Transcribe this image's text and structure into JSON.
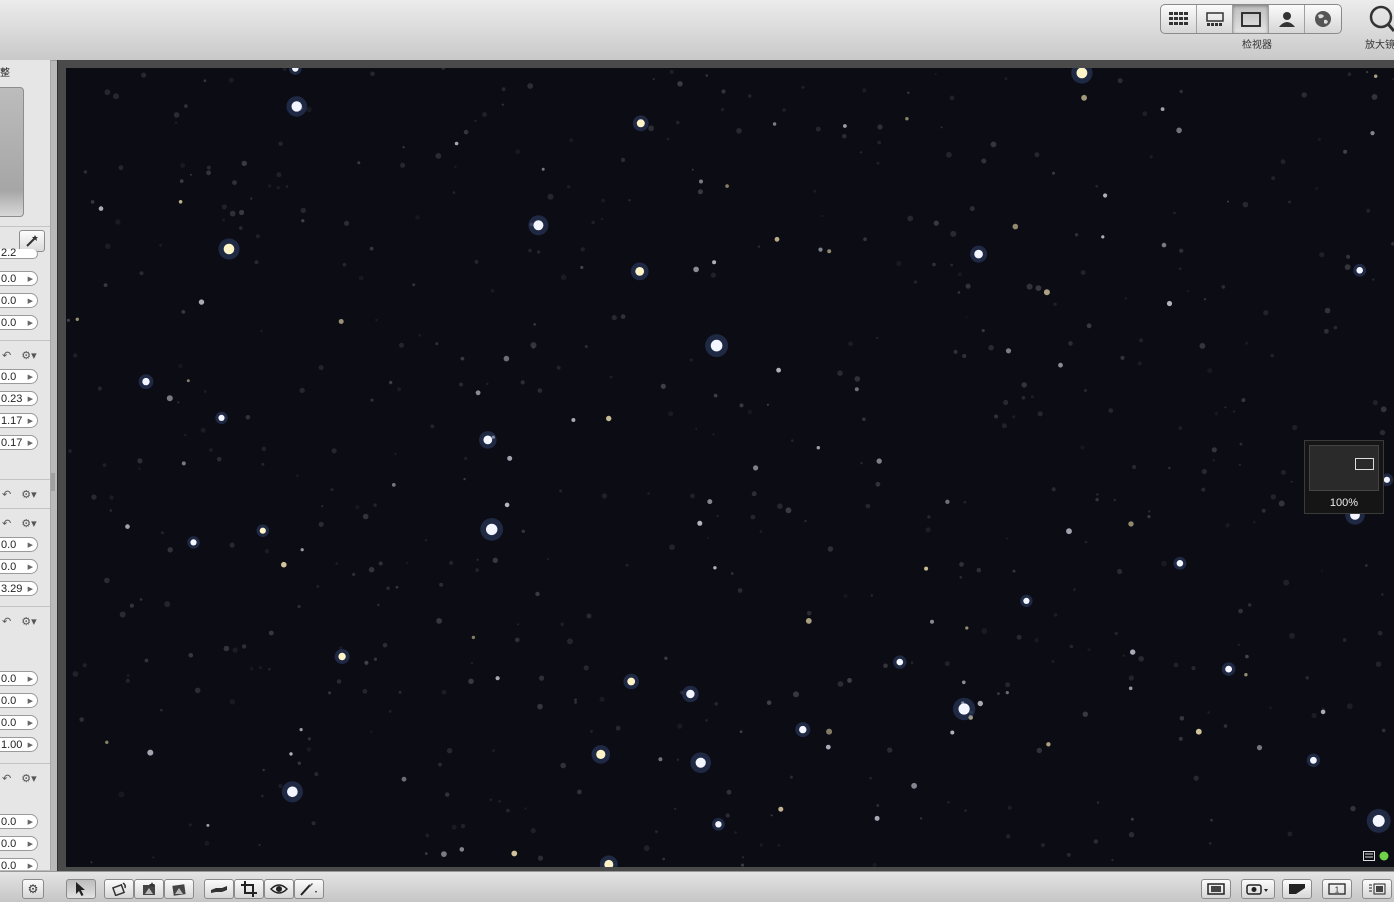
{
  "toolbar": {
    "views": [
      {
        "icon": "grid-view-icon",
        "active": false
      },
      {
        "icon": "split-view-icon",
        "active": false
      },
      {
        "icon": "viewer-icon",
        "active": true
      },
      {
        "icon": "faces-icon",
        "active": false
      },
      {
        "icon": "places-icon",
        "active": false
      }
    ],
    "viewer_label": "检视器",
    "zoom_label": "放大镜"
  },
  "adjust_panel": {
    "title": "整",
    "partial_value": "2.2",
    "group1": [
      "0.0",
      "0.0",
      "0.0"
    ],
    "group2": [
      "0.0",
      "0.23",
      "1.17",
      "0.17"
    ],
    "group3": [
      "0.0",
      "0.0",
      "3.29"
    ],
    "group4": [
      "0.0",
      "0.0",
      "0.0",
      "1.00"
    ],
    "group5": [
      "0.0",
      "0.0",
      "0.0"
    ]
  },
  "loupe": {
    "zoom": "100%"
  },
  "colors": {
    "photo_bg": "#0b0c14",
    "panel_bg": "#e6e6e6",
    "viewer_bg": "#4a4a4a"
  }
}
